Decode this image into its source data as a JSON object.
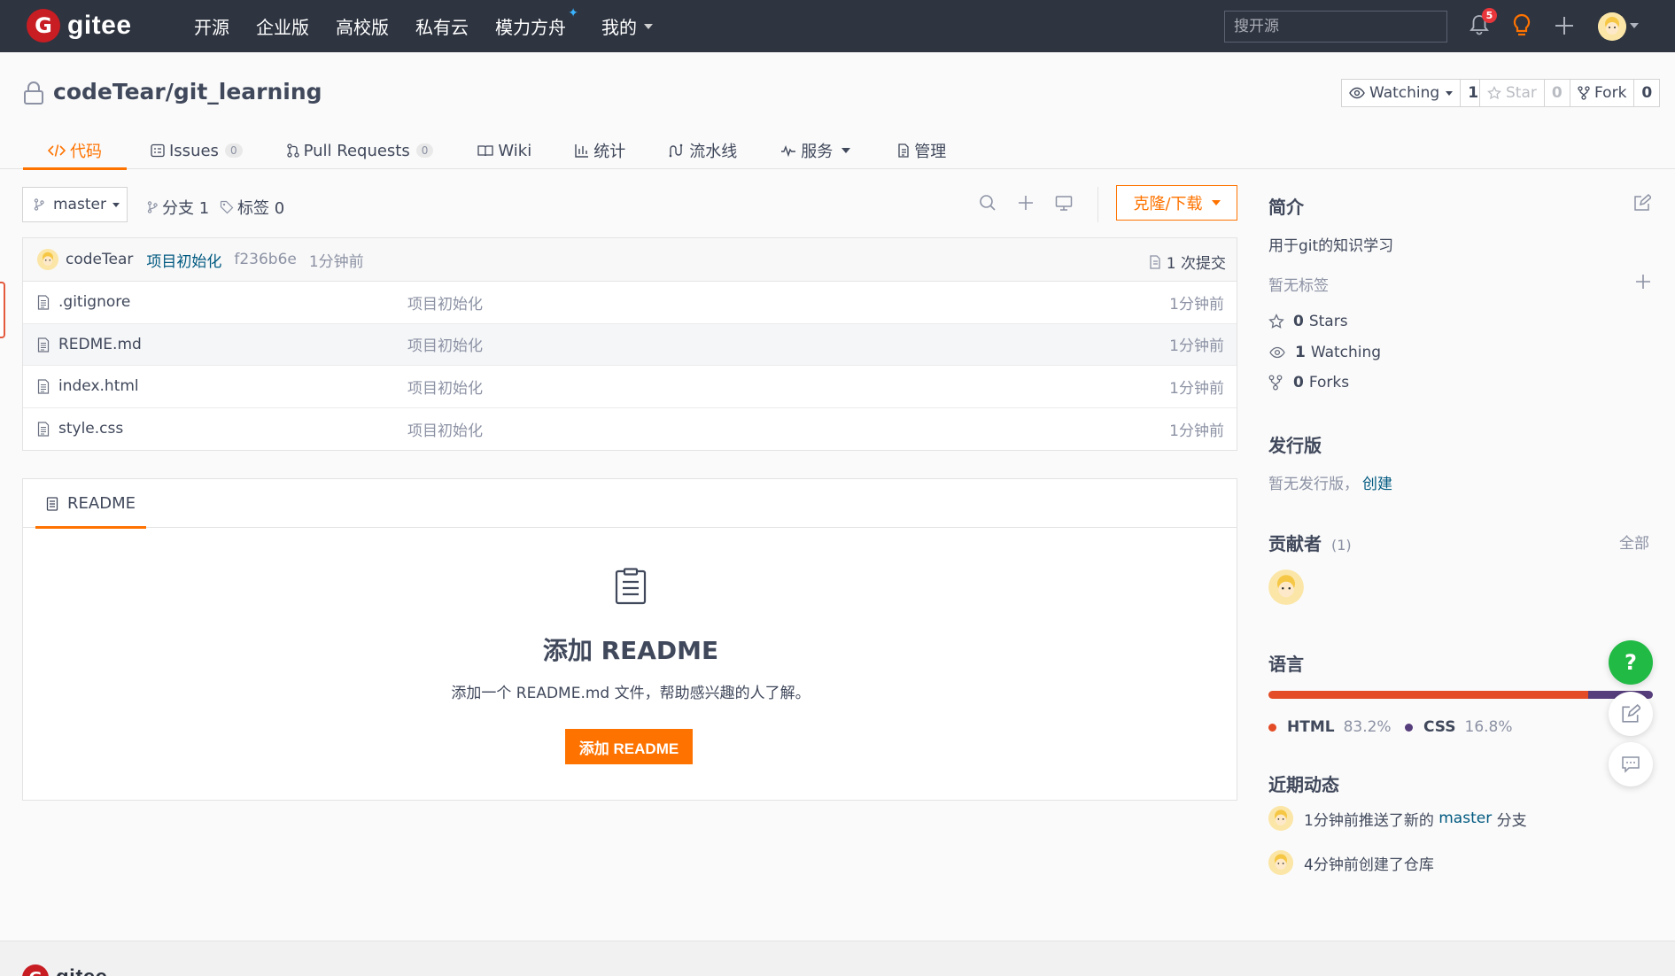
{
  "topnav": {
    "logo_text": "gitee",
    "items": [
      "开源",
      "企业版",
      "高校版",
      "私有云",
      "模力方舟",
      "我的"
    ],
    "search_placeholder": "搜开源",
    "notification_count": "5",
    "colors": {
      "bg": "#2e3440",
      "brand": "#c71d23"
    }
  },
  "repo": {
    "title": "codeTear/git_learning",
    "watching_label": "Watching",
    "watching_count": "1",
    "star_label": "Star",
    "star_count": "0",
    "fork_label": "Fork",
    "fork_count": "0"
  },
  "tabs": [
    {
      "label": "代码",
      "icon": "code-icon"
    },
    {
      "label": "Issues",
      "count": "0",
      "icon": "issues-icon"
    },
    {
      "label": "Pull Requests",
      "count": "0",
      "icon": "pull-request-icon"
    },
    {
      "label": "Wiki",
      "icon": "wiki-icon"
    },
    {
      "label": "统计",
      "icon": "bar-chart-icon"
    },
    {
      "label": "流水线",
      "icon": "pipeline-icon"
    },
    {
      "label": "服务",
      "icon": "pulse-icon"
    },
    {
      "label": "管理",
      "icon": "manage-icon"
    }
  ],
  "toolbar": {
    "branch": "master",
    "branches": "分支 1",
    "tags": "标签 0",
    "clone_label": "克隆/下载"
  },
  "commit": {
    "author": "codeTear",
    "message": "项目初始化",
    "hash": "f236b6e",
    "time": "1分钟前",
    "count_label": "1 次提交"
  },
  "files": [
    {
      "name": ".gitignore",
      "message": "项目初始化",
      "time": "1分钟前"
    },
    {
      "name": "REDME.md",
      "message": "项目初始化",
      "time": "1分钟前"
    },
    {
      "name": "index.html",
      "message": "项目初始化",
      "time": "1分钟前"
    },
    {
      "name": "style.css",
      "message": "项目初始化",
      "time": "1分钟前"
    }
  ],
  "readme": {
    "tab_label": "README",
    "title": "添加 README",
    "description": "添加一个 README.md 文件，帮助感兴趣的人了解。",
    "button": "添加 README"
  },
  "sidebar": {
    "intro_title": "简介",
    "intro_text": "用于git的知识学习",
    "no_tags": "暂无标签",
    "stars_num": "0",
    "stars_label": "Stars",
    "watching_num": "1",
    "watching_label": "Watching",
    "forks_num": "0",
    "forks_label": "Forks",
    "release_title": "发行版",
    "release_text": "暂无发行版，",
    "release_link": "创建",
    "contributors_title": "贡献者",
    "contributors_count": "(1)",
    "contributors_all": "全部",
    "language_title": "语言",
    "languages": [
      {
        "name": "HTML",
        "percent": "83.2%",
        "value": 83.2,
        "color": "#e34c26"
      },
      {
        "name": "CSS",
        "percent": "16.8%",
        "value": 16.8,
        "color": "#563d7c"
      }
    ],
    "activity_title": "近期动态",
    "activity": [
      {
        "prefix": "1分钟前推送了新的 ",
        "branch": "master",
        "suffix": " 分支"
      },
      {
        "text": "4分钟前创建了仓库"
      }
    ]
  },
  "accent": "#fe7300",
  "footer_logo": "gitee"
}
